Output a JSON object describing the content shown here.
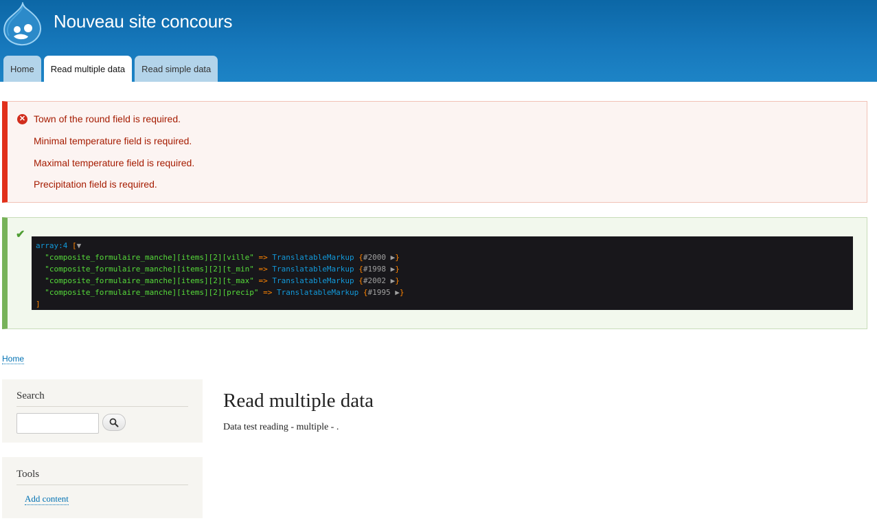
{
  "header": {
    "site_name": "Nouveau site concours",
    "logo_icon": "drupal-drop-logo",
    "tabs": [
      {
        "label": "Home",
        "active": false
      },
      {
        "label": "Read multiple data",
        "active": true
      },
      {
        "label": "Read simple data",
        "active": false
      }
    ]
  },
  "messages": {
    "errors": [
      "Town of the round field is required.",
      "Minimal temperature field is required.",
      "Maximal temperature field is required.",
      "Precipitation field is required."
    ],
    "error_icon": "error-circle-icon",
    "status_icon": "checkmark-icon"
  },
  "dump": {
    "header_type": "array:4",
    "open_bracket": "[",
    "toggle": "▼",
    "close_bracket": "]",
    "rows": [
      {
        "key": "\"composite_formulaire_manche][items][2][ville\"",
        "arrow": "=>",
        "class": "TranslatableMarkup",
        "ref": "#2000"
      },
      {
        "key": "\"composite_formulaire_manche][items][2][t_min\"",
        "arrow": "=>",
        "class": "TranslatableMarkup",
        "ref": "#1998"
      },
      {
        "key": "\"composite_formulaire_manche][items][2][t_max\"",
        "arrow": "=>",
        "class": "TranslatableMarkup",
        "ref": "#2002"
      },
      {
        "key": "\"composite_formulaire_manche][items][2][precip\"",
        "arrow": "=>",
        "class": "TranslatableMarkup",
        "ref": "#1995"
      }
    ],
    "row_toggle": "▶"
  },
  "breadcrumb": {
    "items": [
      "Home"
    ]
  },
  "sidebar": {
    "search": {
      "title": "Search",
      "input_value": "",
      "button_icon": "search-icon"
    },
    "tools": {
      "title": "Tools",
      "links": [
        "Add content"
      ]
    }
  },
  "main": {
    "title": "Read multiple data",
    "body": "Data test reading - multiple - ."
  },
  "colors": {
    "header_blue": "#1779bd",
    "error_red": "#e1301b",
    "status_green": "#77b259",
    "link": "#0071b3"
  }
}
